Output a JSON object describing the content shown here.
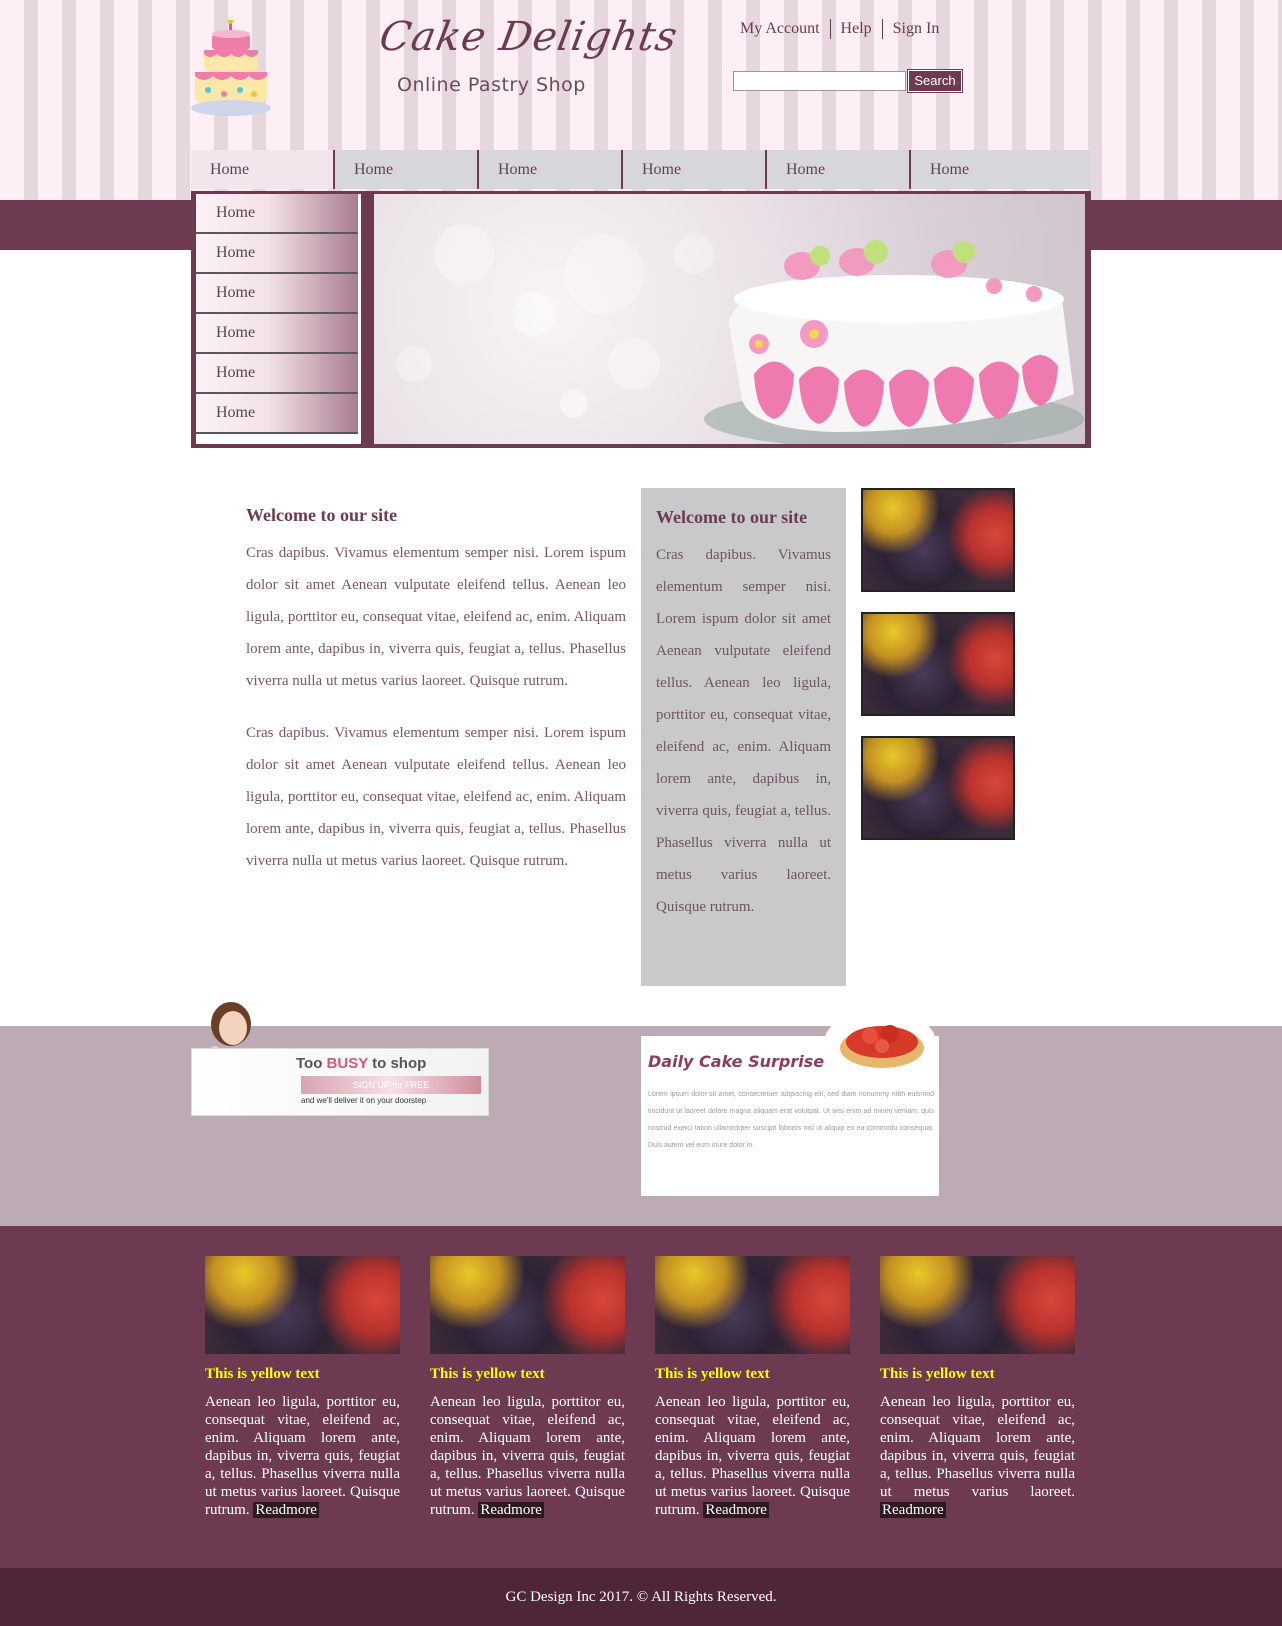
{
  "header": {
    "site_title": "Cake Delights",
    "tagline": "Online Pastry Shop",
    "links": [
      "My Account",
      "Help",
      "Sign In"
    ],
    "search": {
      "placeholder": "",
      "button_label": "Search"
    }
  },
  "nav": {
    "items": [
      "Home",
      "Home",
      "Home",
      "Home",
      "Home",
      "Home"
    ]
  },
  "side_menu": {
    "items": [
      "Home",
      "Home",
      "Home",
      "Home",
      "Home",
      "Home"
    ]
  },
  "main": {
    "welcome": {
      "title": "Welcome to our site",
      "paragraphs": [
        "Cras dapibus. Vivamus elementum semper nisi. Lorem ispum dolor sit amet Aenean vulputate eleifend tellus. Aenean leo ligula, porttitor eu, consequat vitae, eleifend ac, enim. Aliquam lorem ante, dapibus in, viverra quis, feugiat a, tellus. Phasellus viverra nulla ut metus varius laoreet. Quisque rutrum.",
        "Cras dapibus. Vivamus elementum semper nisi. Lorem ispum dolor sit amet Aenean vulputate eleifend tellus. Aenean leo ligula, porttitor eu, consequat vitae, eleifend ac, enim. Aliquam lorem ante, dapibus in, viverra quis, feugiat a, tellus. Phasellus viverra nulla ut metus varius laoreet. Quisque rutrum."
      ]
    },
    "sidebar_box": {
      "title": "Welcome to our site",
      "paragraph": "Cras dapibus. Vivamus elementum semper nisi. Lorem ispum dolor sit amet Aenean vulputate eleifend tellus. Aenean leo ligula, porttitor eu, consequat vitae, eleifend ac, enim. Aliquam lorem ante, dapibus in, viverra quis, feugiat a, tellus. Phasellus viverra nulla ut metus varius laoreet. Quisque rutrum."
    }
  },
  "promo": {
    "busy": {
      "line1_a": "Too ",
      "line1_b": "BUSY",
      "line1_c": " to shop",
      "sign_up": "SIGN UP for FREE",
      "deliver": "and we'll deliver it on your doorstep"
    },
    "daily": {
      "title": "Daily Cake Surprise",
      "text": "Lorem ipsum dolor sit amet, consectetuer adipiscing elit, sed diam nonummy nibh euismod tincidunt ut laoreet dolore magna aliquam erat volutpat. Ut wisi enim ad minim veniam, quis nostrud exerci tation ullamcorper suscipit lobortis nisl ut aliquip ex ea commodo consequat. Duis autem vel eum iriure dolor in."
    }
  },
  "cards": [
    {
      "title": "This is yellow text",
      "text": "Aenean leo ligula, porttitor eu, consequat vitae, eleifend ac, enim. Aliquam lorem ante, dapibus in, viverra quis, feugiat a, tellus. Phasellus viverra nulla ut metus varius laoreet. Quisque rutrum.",
      "readmore": "Readmore"
    },
    {
      "title": "This is yellow text",
      "text": "Aenean leo ligula, porttitor eu, consequat vitae, eleifend ac, enim. Aliquam lorem ante, dapibus in, viverra quis, feugiat a, tellus. Phasellus viverra nulla ut metus varius laoreet. Quisque rutrum.",
      "readmore": "Readmore"
    },
    {
      "title": "This is yellow text",
      "text": "Aenean leo ligula, porttitor eu, consequat vitae, eleifend ac, enim. Aliquam lorem ante, dapibus in, viverra quis, feugiat a, tellus. Phasellus viverra nulla ut metus varius laoreet. Quisque rutrum.",
      "readmore": "Readmore"
    },
    {
      "title": "This is yellow text",
      "text": "Aenean leo ligula, porttitor eu, consequat vitae, eleifend ac, enim. Aliquam lorem ante, dapibus in, viverra quis, feugiat a, tellus. Phasellus viverra nulla ut metus varius laoreet.",
      "readmore": "Readmore"
    }
  ],
  "footer": {
    "copyright": "GC Design Inc 2017. © All Rights Reserved."
  },
  "colors": {
    "brand": "#6d3a51",
    "stripe_light": "#fdeff3",
    "stripe_dark": "#e6d6dd",
    "card_title": "#ffff00",
    "promo_band": "#bcaab4",
    "footer": "#4f2538"
  },
  "icons": [
    "cake-logo-icon",
    "scroll-up-icon",
    "scroll-down-icon"
  ]
}
